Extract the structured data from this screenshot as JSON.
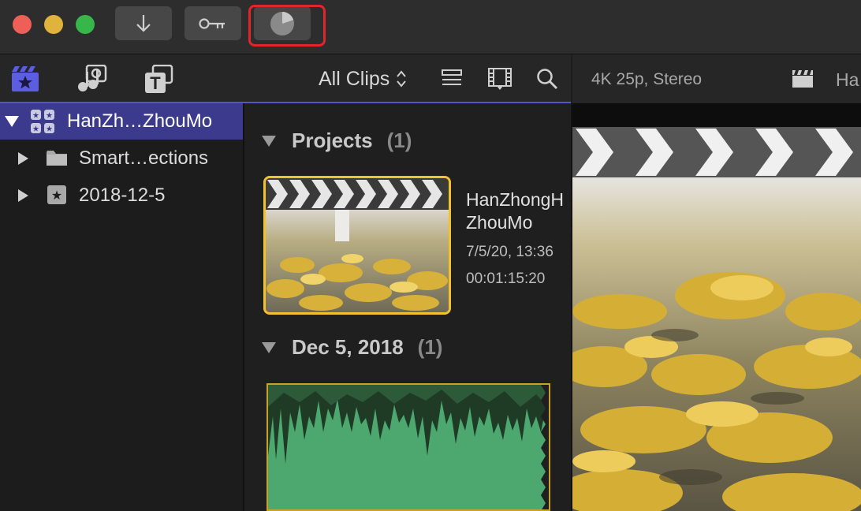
{
  "toolbar": {
    "import_icon": "down-arrow-icon",
    "keyword_icon": "key-icon",
    "background_tasks_icon": "pie-progress-icon"
  },
  "library_toolbar": {
    "icons": [
      "libraries-icon",
      "photos-audio-icon",
      "titles-generators-icon"
    ]
  },
  "browser_toolbar": {
    "filter_label": "All Clips",
    "icons": [
      "list-view-icon",
      "filmstrip-icon",
      "search-icon"
    ]
  },
  "sidebar": {
    "items": [
      {
        "label": "HanZh…ZhouMo",
        "icon": "library-icon",
        "expanded": true,
        "selected": true
      },
      {
        "label": "Smart…ections",
        "icon": "folder-icon",
        "expanded": false
      },
      {
        "label": "2018-12-5",
        "icon": "event-star-icon",
        "expanded": false
      }
    ]
  },
  "browser": {
    "sections": [
      {
        "title": "Projects",
        "count": "(1)"
      },
      {
        "title": "Dec 5, 2018",
        "count": "(1)"
      }
    ],
    "project": {
      "name_line1": "HanZhongH",
      "name_line2": "ZhouMo",
      "date": "7/5/20, 13:36",
      "duration": "00:01:15:20"
    }
  },
  "viewer": {
    "format": "4K 25p, Stereo",
    "title_fragment": "Ha"
  },
  "colors": {
    "selection": "#3c3a8c",
    "accent_line": "#5456c8",
    "clip_border": "#f2c12e",
    "waveform": "#4da86f",
    "highlight": "#e0262a"
  }
}
